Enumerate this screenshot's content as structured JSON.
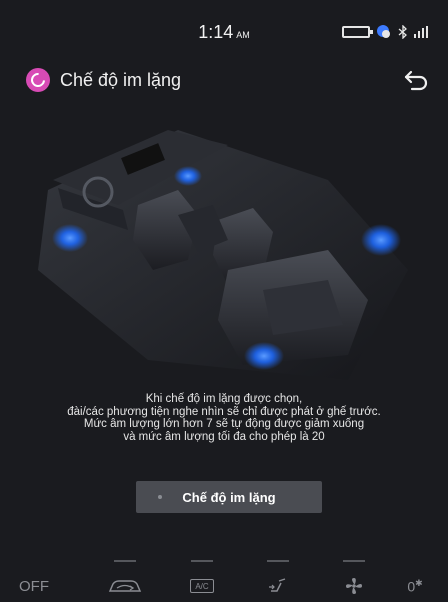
{
  "status_bar": {
    "time": "1:14",
    "ampm": "AM"
  },
  "header": {
    "title": "Chế độ im lặng"
  },
  "description": {
    "lines": [
      "Khi chế độ im lặng được chọn,",
      "đài/các phương tiện nghe nhìn sẽ chỉ được phát ở ghế trước.",
      "Mức âm lượng lớn hơn 7 sẽ tự động được giảm xuống",
      "và mức âm lượng tối đa cho phép là 20"
    ]
  },
  "mode_button": {
    "label": "Chế độ im lặng"
  },
  "climate_bar": {
    "off_label": "OFF",
    "ac_label": "A/C",
    "fan_level": "0"
  },
  "colors": {
    "accent_pink": "#d84bb5",
    "speaker_glow": "#1e6bff",
    "background": "#1a1b1f"
  }
}
